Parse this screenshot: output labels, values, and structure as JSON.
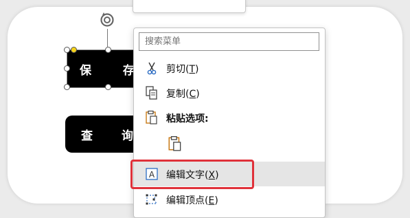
{
  "canvas": {
    "save_shape_text": "保 存",
    "query_shape_text": "查 询"
  },
  "context_menu": {
    "search_placeholder": "搜索菜单",
    "items": [
      {
        "label": "剪切",
        "hotkey": "T",
        "icon": "scissors-icon"
      },
      {
        "label": "复制",
        "hotkey": "C",
        "icon": "copy-icon"
      },
      {
        "label": "粘贴选项:",
        "hotkey": "",
        "icon": "paste-icon"
      },
      {
        "label": "",
        "hotkey": "",
        "icon": "paste-keep-formatting-icon"
      },
      {
        "label": "编辑文字",
        "hotkey": "X",
        "icon": "edit-text-icon"
      },
      {
        "label": "编辑顶点",
        "hotkey": "E",
        "icon": "edit-points-icon"
      }
    ]
  },
  "colors": {
    "highlight_box": "#e0313a",
    "selected_handle": "#f6d31a",
    "menu_hover": "#e5e5e5"
  }
}
